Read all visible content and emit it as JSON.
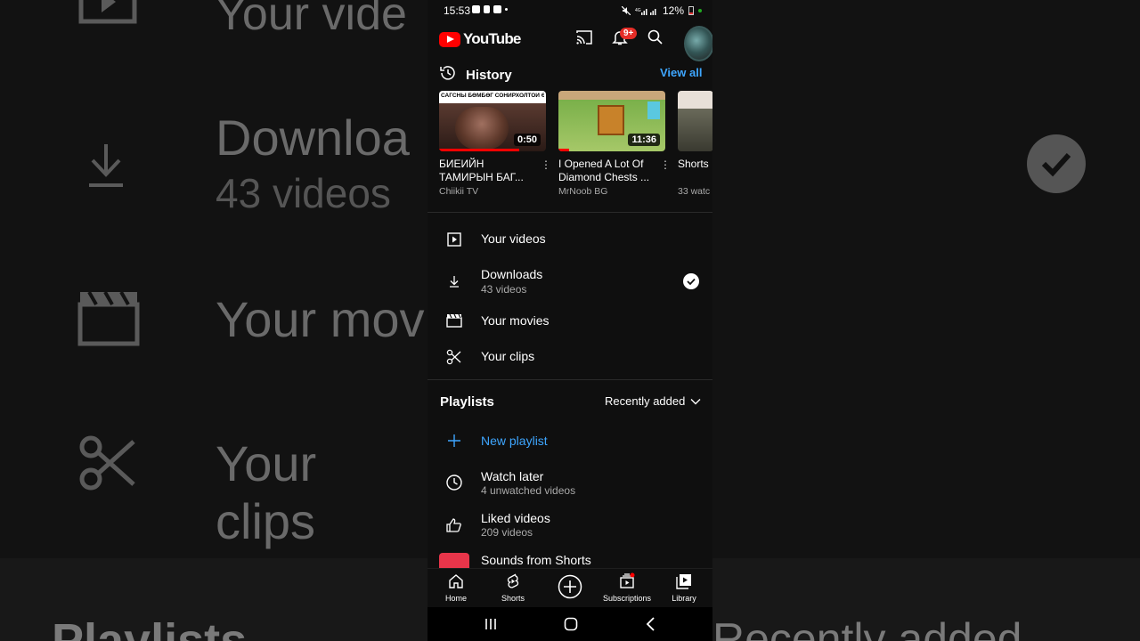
{
  "status_bar": {
    "time": "15:53",
    "battery": "12%"
  },
  "header": {
    "app_name": "YouTube",
    "notification_badge": "9+"
  },
  "history": {
    "title": "History",
    "view_all": "View all",
    "items": [
      {
        "thumb_text": "САГСНЫ БӨМБӨГ СОНИРХОЛТОЙ ӨД",
        "duration": "0:50",
        "title": "БИЕИЙН ТАМИРЫН БАГ...",
        "channel": "Chiikii TV",
        "progress": 0.75
      },
      {
        "duration": "11:36",
        "title": "I Opened A Lot Of Diamond Chests ...",
        "channel": "MrNoob BG",
        "progress": 0.1
      },
      {
        "title": "Shorts",
        "channel": "33 watc"
      }
    ]
  },
  "library_items": [
    {
      "label": "Your videos",
      "icon": "play-square-icon"
    },
    {
      "label": "Downloads",
      "sub": "43 videos",
      "icon": "download-icon"
    },
    {
      "label": "Your movies",
      "icon": "clapperboard-icon"
    },
    {
      "label": "Your clips",
      "icon": "scissors-icon"
    }
  ],
  "playlists": {
    "title": "Playlists",
    "sort_label": "Recently added",
    "new_playlist": "New playlist",
    "items": [
      {
        "label": "Watch later",
        "sub": "4 unwatched videos",
        "icon": "clock-icon"
      },
      {
        "label": "Liked videos",
        "sub": "209 videos",
        "icon": "thumbs-up-icon"
      },
      {
        "label": "Sounds from Shorts",
        "icon": "shorts-sound-icon"
      }
    ]
  },
  "nav": {
    "home": "Home",
    "shorts": "Shorts",
    "subscriptions": "Subscriptions",
    "library": "Library"
  },
  "background": {
    "downloads": "Downloa",
    "downloads_sub": "43 videos",
    "your_movies": "Your mov",
    "your_clips": "Your clips",
    "playlists": "Playlists",
    "recently_added": "Recently added",
    "your_videos": "Your vide"
  },
  "colors": {
    "accent_blue": "#3ea6ff",
    "brand_red": "#ff0000",
    "background": "#0f0f0f"
  }
}
